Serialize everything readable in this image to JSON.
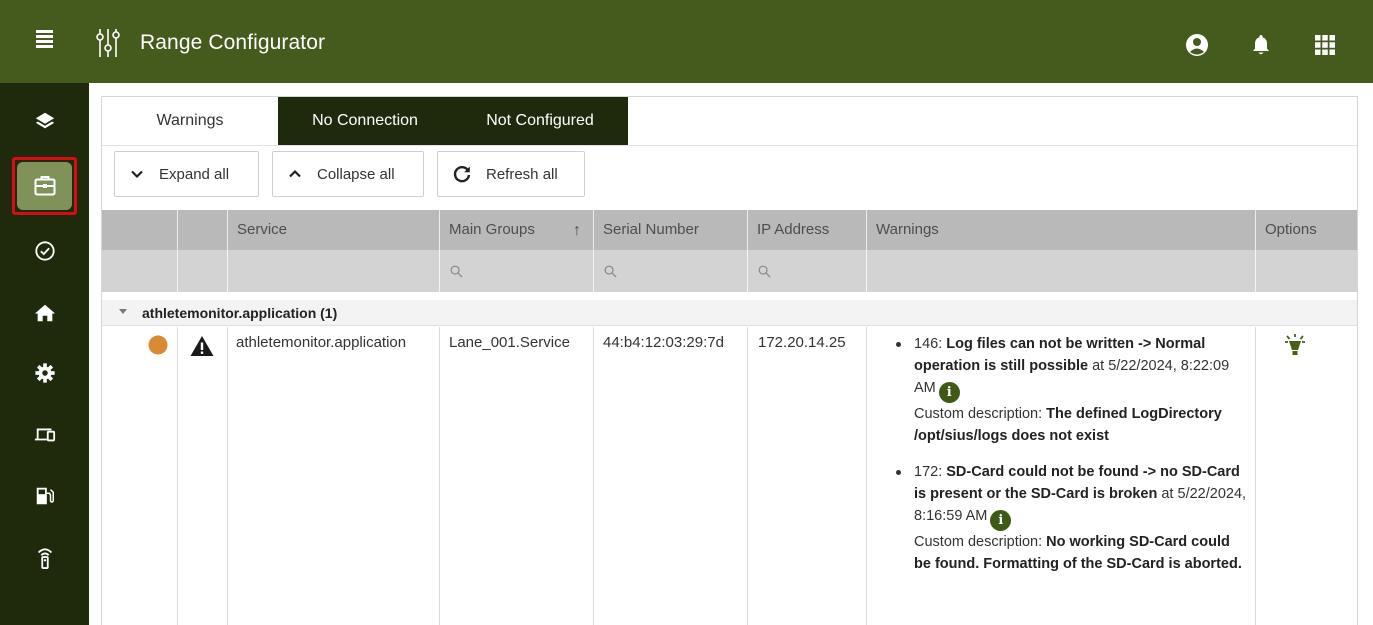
{
  "app": {
    "title": "Range Configurator"
  },
  "tabs": [
    {
      "label": "Warnings"
    },
    {
      "label": "No Connection"
    },
    {
      "label": "Not Configured"
    }
  ],
  "toolbar": {
    "expand_label": "Expand all",
    "collapse_label": "Collapse all",
    "refresh_label": "Refresh all"
  },
  "table": {
    "columns": {
      "service": "Service",
      "main_groups": "Main Groups",
      "sort_indicator": "↑",
      "serial_number": "Serial Number",
      "ip_address": "IP Address",
      "warnings": "Warnings",
      "options": "Options"
    },
    "group": {
      "label": "athletemonitor.application (1)"
    },
    "rows": [
      {
        "service": "athletemonitor.application",
        "main_groups": "Lane_001.Service",
        "serial_number": "44:b4:12:03:29:7d",
        "ip_address": "172.20.14.25",
        "status_color": "#d98a33",
        "warnings": [
          {
            "code": "146: ",
            "message": "Log files can not be written -> Normal operation is still possible",
            "at": " at ",
            "timestamp": "5/22/2024, 8:22:09 AM",
            "custom_label": "Custom description: ",
            "custom_text": "The defined LogDirectory /opt/sius/logs does not exist"
          },
          {
            "code": "172: ",
            "message": "SD-Card could not be found -> no SD-Card is present or the SD-Card is broken",
            "at": " at ",
            "timestamp": "5/22/2024, 8:16:59 AM",
            "custom_label": "Custom description: ",
            "custom_text": "No working SD-Card could be found. Formatting of the SD-Card is aborted."
          }
        ]
      }
    ]
  },
  "icons": {
    "info_glyph": "i"
  },
  "colors": {
    "topbar": "#455a1d",
    "sidenav": "#1f2a0d",
    "active_nav": "#7e925a",
    "highlight": "#d60d17",
    "status_dot": "#d98a33"
  }
}
